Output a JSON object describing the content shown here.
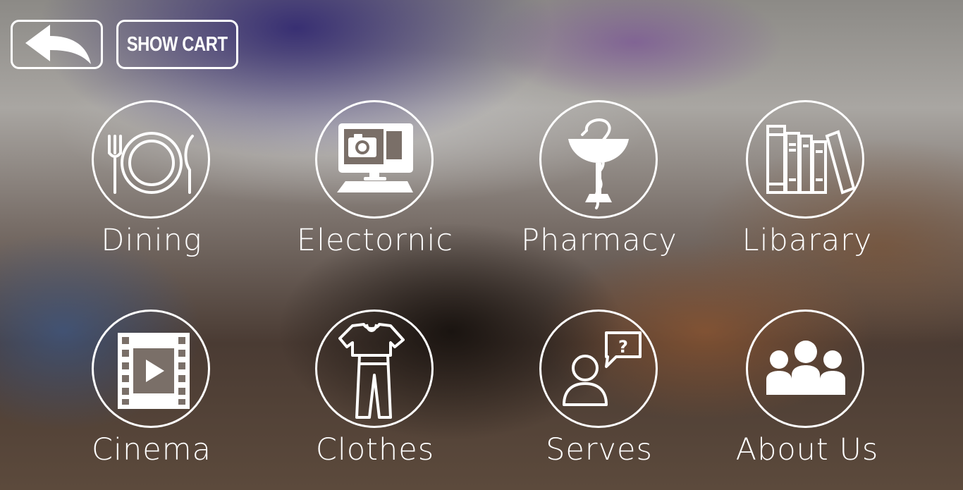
{
  "toolbar": {
    "back_icon": "back-arrow-icon",
    "show_cart_label": "SHOW CART"
  },
  "categories": [
    {
      "label": "Dining",
      "icon": "dining-icon"
    },
    {
      "label": "Electornic",
      "icon": "electronics-icon"
    },
    {
      "label": "Pharmacy",
      "icon": "pharmacy-icon"
    },
    {
      "label": "Libarary",
      "icon": "library-icon"
    },
    {
      "label": "Cinema",
      "icon": "cinema-icon"
    },
    {
      "label": "Clothes",
      "icon": "clothes-icon"
    },
    {
      "label": "Serves",
      "icon": "services-icon"
    },
    {
      "label": "About Us",
      "icon": "about-us-icon"
    }
  ],
  "colors": {
    "foreground": "#ffffff"
  }
}
